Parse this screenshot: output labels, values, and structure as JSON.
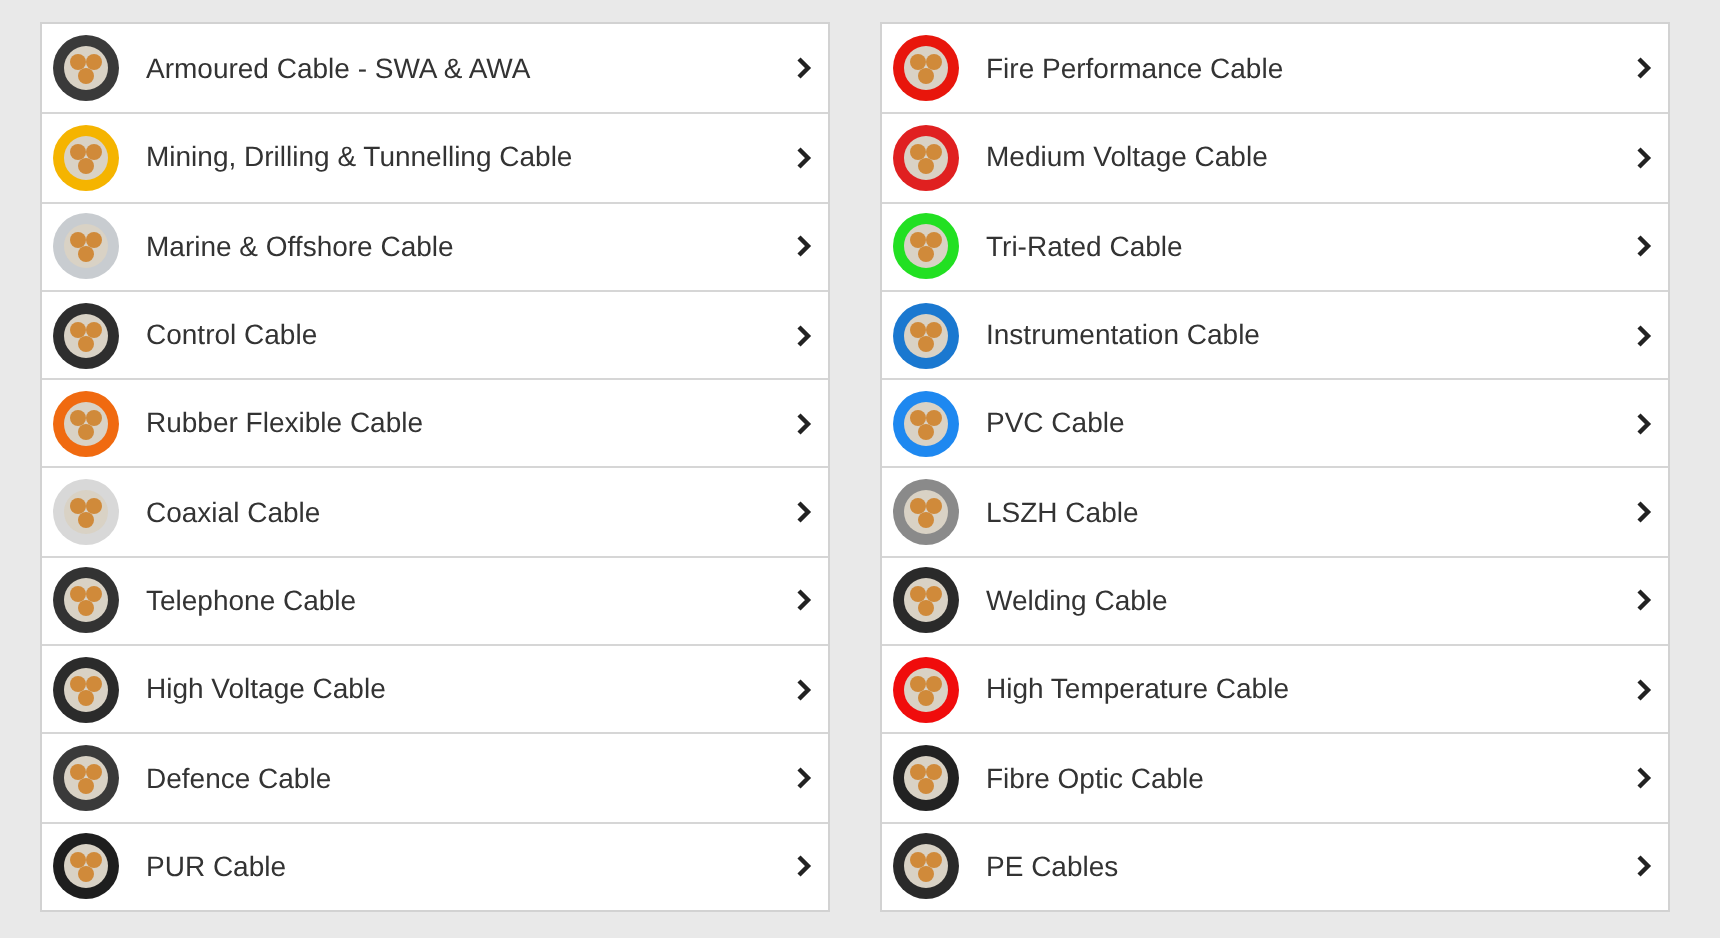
{
  "columns": [
    {
      "items": [
        {
          "label": "Armoured Cable - SWA & AWA",
          "color": "#3a3a3a"
        },
        {
          "label": "Mining, Drilling & Tunnelling Cable",
          "color": "#f5b400"
        },
        {
          "label": "Marine & Offshore Cable",
          "color": "#c8ccd0"
        },
        {
          "label": "Control Cable",
          "color": "#2e2e2e"
        },
        {
          "label": "Rubber Flexible Cable",
          "color": "#f06a10"
        },
        {
          "label": "Coaxial Cable",
          "color": "#d8d8d8"
        },
        {
          "label": "Telephone Cable",
          "color": "#333333"
        },
        {
          "label": "High Voltage Cable",
          "color": "#2b2b2b"
        },
        {
          "label": "Defence Cable",
          "color": "#3a3a3a"
        },
        {
          "label": "PUR Cable",
          "color": "#1e1e1e"
        }
      ]
    },
    {
      "items": [
        {
          "label": "Fire Performance Cable",
          "color": "#e8160c"
        },
        {
          "label": "Medium Voltage Cable",
          "color": "#e02020"
        },
        {
          "label": "Tri-Rated Cable",
          "color": "#22e022"
        },
        {
          "label": "Instrumentation Cable",
          "color": "#1a78d0"
        },
        {
          "label": "PVC Cable",
          "color": "#1e88f0"
        },
        {
          "label": "LSZH Cable",
          "color": "#8a8a8a"
        },
        {
          "label": "Welding Cable",
          "color": "#2a2a2a"
        },
        {
          "label": "High Temperature Cable",
          "color": "#f00c0c"
        },
        {
          "label": "Fibre Optic Cable",
          "color": "#222222"
        },
        {
          "label": "PE Cables",
          "color": "#2a2a2a"
        }
      ]
    }
  ]
}
